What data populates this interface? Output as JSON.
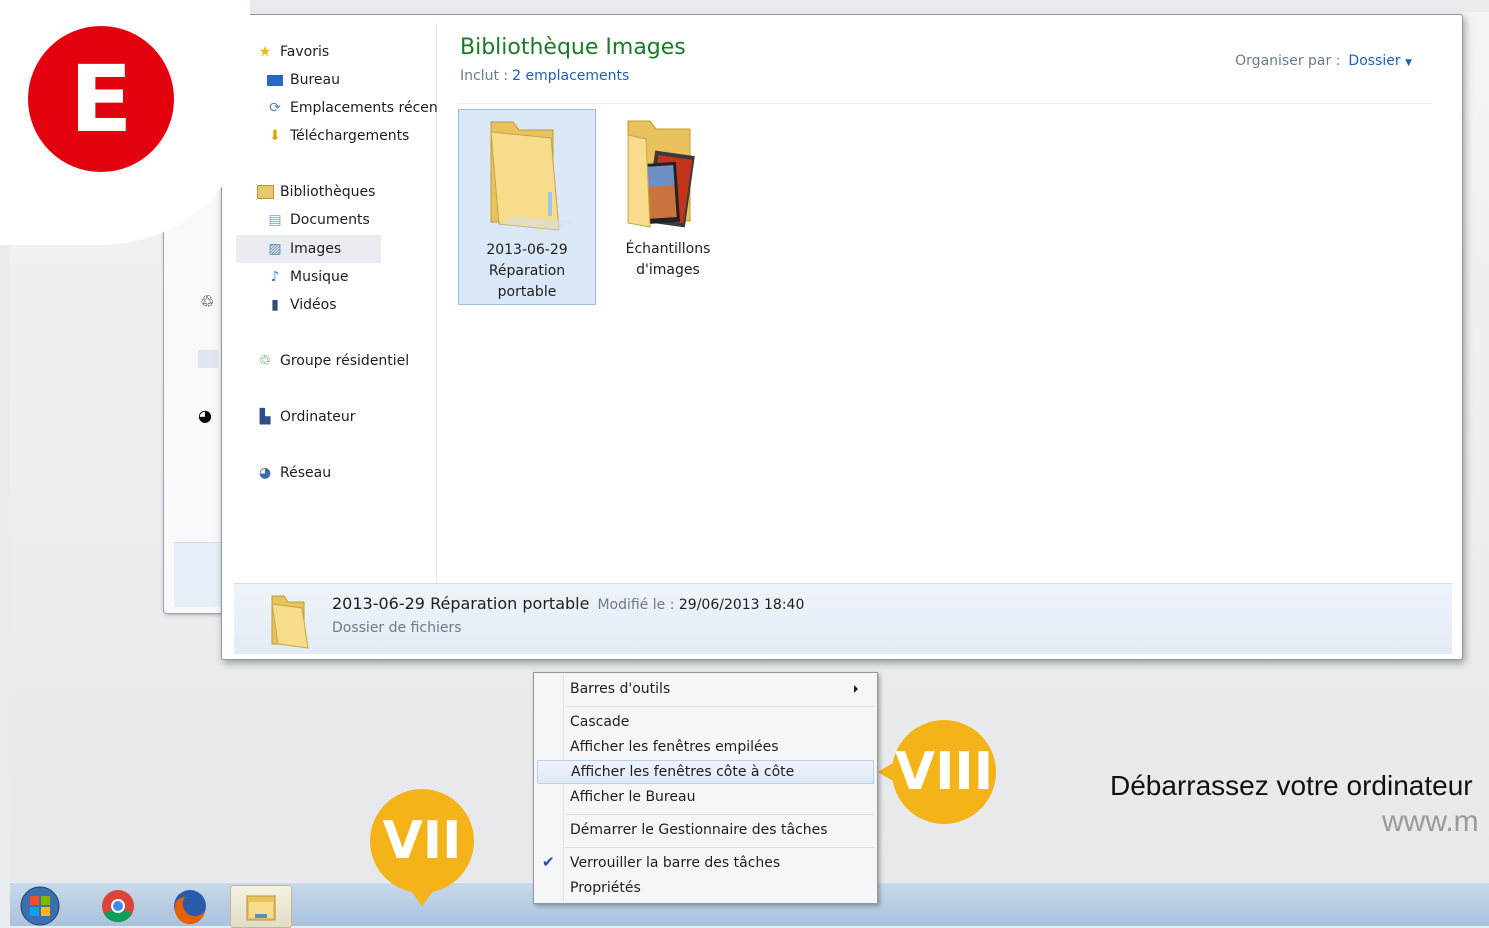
{
  "badge": {
    "letter": "E",
    "color": "#e3000f"
  },
  "markers": {
    "taskbar_marker": "VII",
    "menu_marker": "VIII",
    "color": "#f5b31a"
  },
  "nav": {
    "favorites": [
      {
        "label": "Favoris",
        "icon": "star-icon"
      },
      {
        "label": "Bureau",
        "icon": "desktop-icon"
      },
      {
        "label": "Emplacements récen",
        "icon": "recent-places-icon"
      },
      {
        "label": "Téléchargements",
        "icon": "downloads-icon"
      }
    ],
    "libraries": [
      {
        "label": "Bibliothèques",
        "icon": "libraries-icon"
      },
      {
        "label": "Documents",
        "icon": "documents-icon"
      },
      {
        "label": "Images",
        "icon": "pictures-icon",
        "selected": true
      },
      {
        "label": "Musique",
        "icon": "music-icon"
      },
      {
        "label": "Vidéos",
        "icon": "videos-icon"
      }
    ],
    "homegroup": {
      "label": "Groupe résidentiel",
      "icon": "homegroup-icon"
    },
    "computer": {
      "label": "Ordinateur",
      "icon": "computer-icon"
    },
    "network": {
      "label": "Réseau",
      "icon": "network-icon"
    }
  },
  "library": {
    "title": "Bibliothèque Images",
    "includes_label": "Inclut :",
    "includes_link": "2 emplacements",
    "arrange_label": "Organiser par :",
    "arrange_value": "Dossier"
  },
  "items": [
    {
      "line1": "2013-06-29",
      "line2": "Réparation",
      "line3": "portable",
      "selected": true
    },
    {
      "line1": "Échantillons",
      "line2": "d'images",
      "line3": ""
    }
  ],
  "details": {
    "name": "2013-06-29 Réparation portable",
    "modified_label": "Modifié le :",
    "modified_value": "29/06/2013 18:40",
    "type": "Dossier de fichiers"
  },
  "context_menu": {
    "toolbars": "Barres d'outils",
    "cascade": "Cascade",
    "stacked": "Afficher les fenêtres empilées",
    "side_by_side": "Afficher les fenêtres côte à côte",
    "show_desktop": "Afficher le Bureau",
    "task_manager": "Démarrer le Gestionnaire des tâches",
    "lock_taskbar": "Verrouiller la barre des tâches",
    "properties": "Propriétés"
  },
  "promo": {
    "headline": "Débarrassez votre ordinateur",
    "url": "www.m"
  }
}
